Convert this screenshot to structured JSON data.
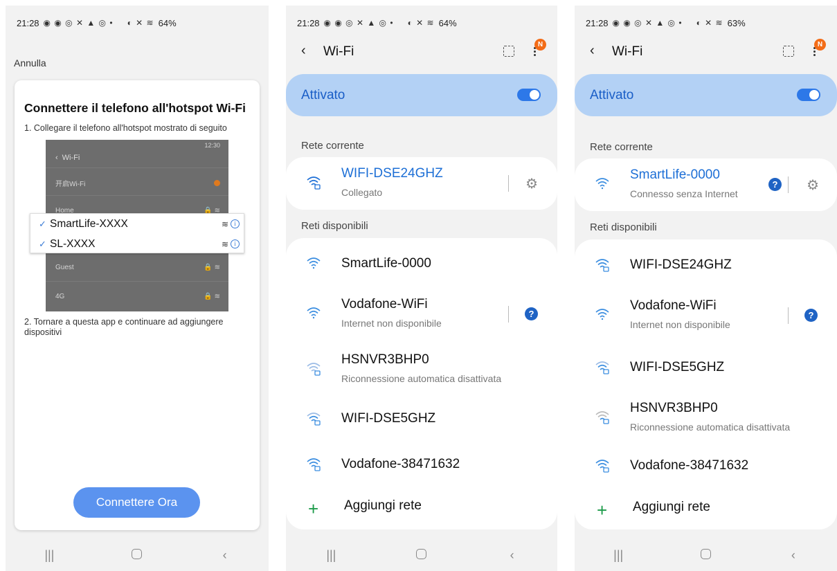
{
  "panel1": {
    "status_time": "21:28",
    "status_icons": "◉ ◉ ◎ ✕ ▲ ◎ •",
    "status_right": "◐ ✕ ≋",
    "status_battery": "64%",
    "cancel_label": "Annulla",
    "title": "Connettere il telefono all'hotspot Wi-Fi",
    "step1": "1. Collegare il telefono all'hotspot mostrato di seguito",
    "mock": {
      "time": "12:30",
      "header": "Wi-Fi",
      "wifi_on": "开启Wi-Fi",
      "home": "Home",
      "guest": "Guest",
      "fourg": "4G"
    },
    "popup": {
      "item1": "SmartLife-XXXX",
      "item2": "SL-XXXX"
    },
    "step2": "2. Tornare a questa app e continuare ad aggiungere dispositivi",
    "connect_button": "Connettere Ora"
  },
  "panel2": {
    "status_time": "21:28",
    "status_icons": "◉ ◉ ◎ ✕ ▲ ◎ •",
    "status_right": "◐ ✕ ≋",
    "status_battery": "64%",
    "title": "Wi-Fi",
    "badge": "N",
    "toggle_label": "Attivato",
    "current_section": "Rete corrente",
    "current": {
      "name": "WIFI-DSE24GHZ",
      "sub": "Collegato"
    },
    "available_section": "Reti disponibili",
    "networks": [
      {
        "name": "SmartLife-0000",
        "sub": ""
      },
      {
        "name": "Vodafone-WiFi",
        "sub": "Internet non disponibile"
      },
      {
        "name": "HSNVR3BHP0",
        "sub": "Riconnessione automatica disattivata"
      },
      {
        "name": "WIFI-DSE5GHZ",
        "sub": ""
      },
      {
        "name": "Vodafone-38471632",
        "sub": ""
      }
    ],
    "add_network": "Aggiungi rete"
  },
  "panel3": {
    "status_time": "21:28",
    "status_icons": "◉ ◉ ◎ ✕ ▲ ◎ •",
    "status_right": "◐ ✕ ≋",
    "status_battery": "63%",
    "title": "Wi-Fi",
    "badge": "N",
    "toggle_label": "Attivato",
    "current_section": "Rete corrente",
    "current": {
      "name": "SmartLife-0000",
      "sub": "Connesso senza Internet"
    },
    "available_section": "Reti disponibili",
    "networks": [
      {
        "name": "WIFI-DSE24GHZ",
        "sub": ""
      },
      {
        "name": "Vodafone-WiFi",
        "sub": "Internet non disponibile"
      },
      {
        "name": "WIFI-DSE5GHZ",
        "sub": ""
      },
      {
        "name": "HSNVR3BHP0",
        "sub": "Riconnessione automatica disattivata"
      },
      {
        "name": "Vodafone-38471632",
        "sub": ""
      }
    ],
    "add_network": "Aggiungi rete"
  },
  "icons": {
    "wifi": "wifi-icon",
    "wifi_lock": "wifi-lock-icon",
    "gear": "gear-icon",
    "help": "help-icon",
    "back": "back-chevron-icon",
    "qr": "qr-scan-icon",
    "more": "more-vert-icon",
    "plus": "plus-icon"
  },
  "colors": {
    "accent_blue": "#1d6fd6",
    "toggle_bar": "#b3d1f5",
    "button_blue": "#5b93ef",
    "add_green": "#1d9b4a",
    "badge_orange": "#f36c17"
  }
}
